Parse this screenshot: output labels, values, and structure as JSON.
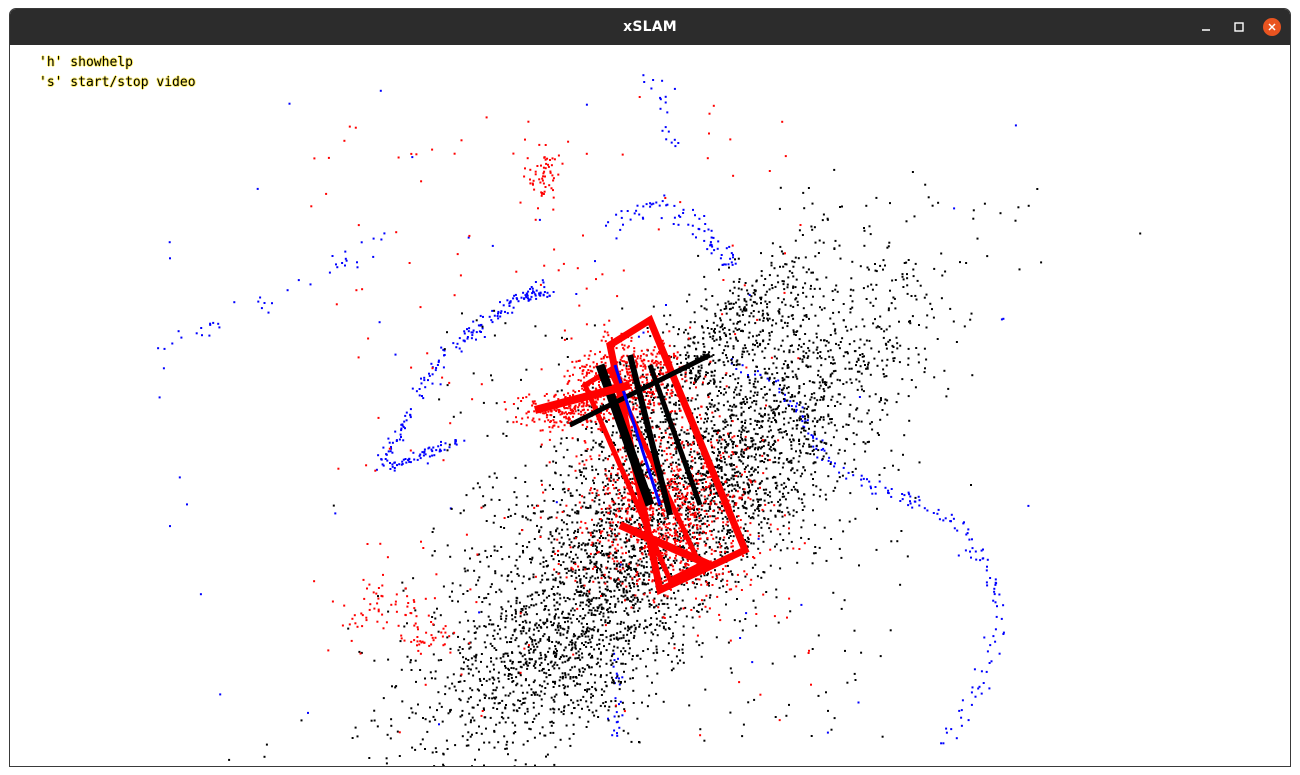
{
  "window": {
    "title": "xSLAM",
    "buttons": {
      "minimize": "minimize-icon",
      "maximize": "maximize-icon",
      "close": "close-icon"
    },
    "close_color": "#e95420",
    "titlebar_color": "#2c2c2c"
  },
  "overlay": {
    "help_lines": [
      "'h' showhelp",
      "'s' start/stop video"
    ]
  },
  "colors": {
    "map_points_a": "#000000",
    "map_points_b": "#ff0000",
    "trajectory": "#0000ff",
    "background": "#ffffff"
  }
}
